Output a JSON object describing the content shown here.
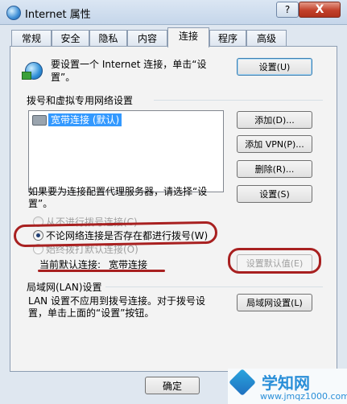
{
  "window": {
    "title": "Internet 属性",
    "help_label": "?",
    "close_label": "X"
  },
  "tabs": [
    "常规",
    "安全",
    "隐私",
    "内容",
    "连接",
    "程序",
    "高级"
  ],
  "active_tab": "连接",
  "setup": {
    "text_line1": "要设置一个 Internet 连接，单击“设",
    "text_line2": "置”。",
    "button_label": "设置(U)"
  },
  "dialup": {
    "group_title": "拨号和虚拟专用网络设置",
    "connections": [
      "宽带连接 (默认)"
    ],
    "add_label": "添加(D)...",
    "add_vpn_label": "添加 VPN(P)...",
    "remove_label": "删除(R)...",
    "proxy_text_line1": "如果要为连接配置代理服务器，请选择“设",
    "proxy_text_line2": "置”。",
    "settings_label": "设置(S)"
  },
  "dial_options": [
    {
      "label": "从不进行拨号连接(C)",
      "checked": false
    },
    {
      "label": "不论网络连接是否存在都进行拨号(W)",
      "checked": true
    },
    {
      "label": "始终拨打默认连接(O)",
      "checked": false
    }
  ],
  "default_connection": {
    "label": "当前默认连接:",
    "value": "宽带连接",
    "set_default_label": "设置默认值(E)"
  },
  "lan": {
    "group_title": "局域网(LAN)设置",
    "text_line1": "LAN 设置不应用到拨号连接。对于拨号设",
    "text_line2": "置，单击上面的“设置”按钮。",
    "button_label": "局域网设置(L)"
  },
  "footer": {
    "ok_label": "确定"
  },
  "watermark": {
    "title": "学知网",
    "url": "www.jmqz1000.com"
  },
  "colors": {
    "annotation": "#a82020",
    "selection": "#3399ff",
    "close_button": "#c2402a"
  }
}
